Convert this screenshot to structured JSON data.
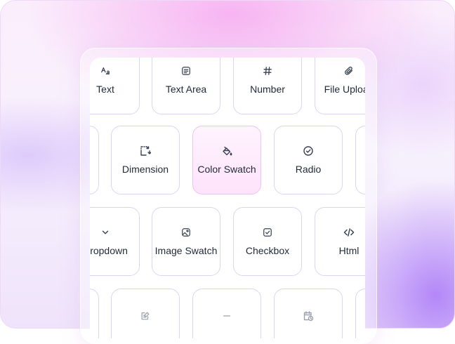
{
  "fields": {
    "row1": [
      {
        "label": "Text",
        "icon": "font-size-icon"
      },
      {
        "label": "Text Area",
        "icon": "text-area-icon"
      },
      {
        "label": "Number",
        "icon": "hash-icon"
      },
      {
        "label": "File Upload",
        "icon": "paperclip-icon"
      }
    ],
    "row2": [
      {
        "label": "",
        "icon": ""
      },
      {
        "label": "Dimension",
        "icon": "dimension-icon"
      },
      {
        "label": "Color Swatch",
        "icon": "paint-bucket-icon",
        "state": "hover"
      },
      {
        "label": "Radio",
        "icon": "radio-check-icon"
      },
      {
        "label": "",
        "icon": ""
      }
    ],
    "row3": [
      {
        "label": "Dropdown",
        "icon": "chevron-down-icon"
      },
      {
        "label": "Image Swatch",
        "icon": "image-icon"
      },
      {
        "label": "Checkbox",
        "icon": "checkbox-icon"
      },
      {
        "label": "Html",
        "icon": "code-icon"
      }
    ],
    "row4": [
      {
        "label": "",
        "icon": ""
      },
      {
        "label": "",
        "icon": "edit-note-icon"
      },
      {
        "label": "",
        "icon": "divider-icon"
      },
      {
        "label": "",
        "icon": "calendar-clock-icon"
      },
      {
        "label": "",
        "icon": ""
      }
    ]
  },
  "colors": {
    "tile_border": "#dcd4f5",
    "active_tile_bg": "#fde3fb",
    "text": "#1f2937",
    "icon": "#374151"
  }
}
